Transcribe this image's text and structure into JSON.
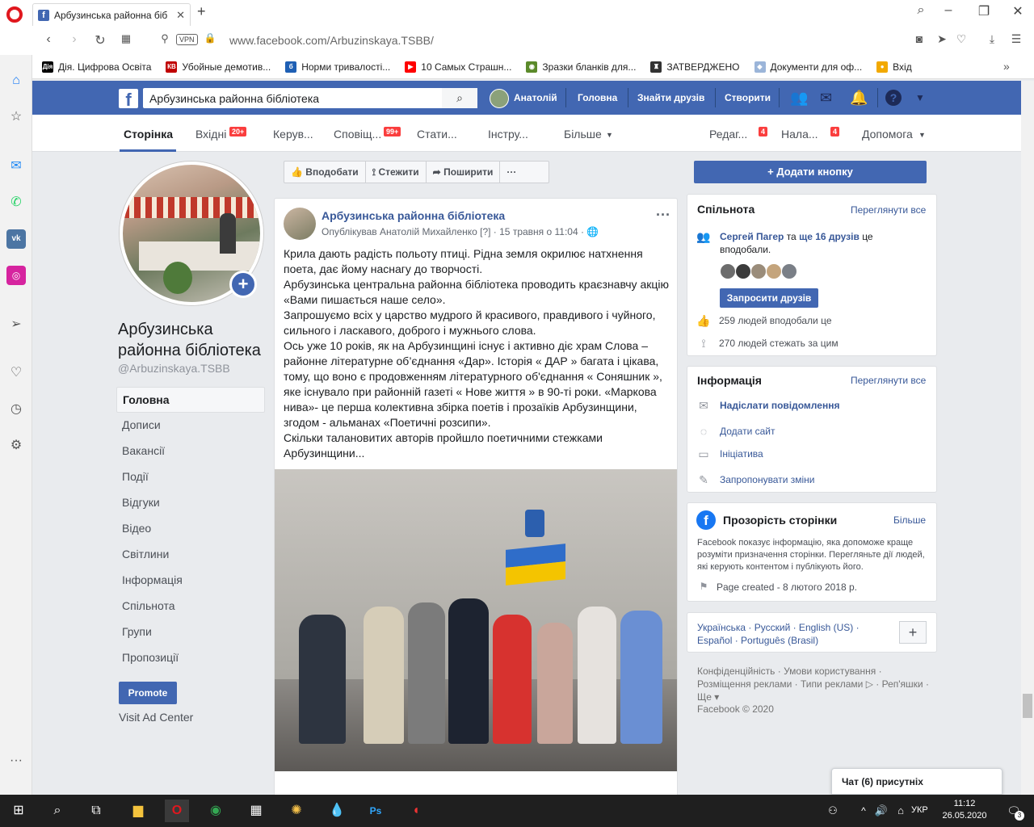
{
  "browser": {
    "tab_title": "Арбузинська районна біб",
    "url": "www.facebook.com/Arbuzinskaya.TSBB/",
    "vpn_label": "VPN",
    "bookmarks": [
      {
        "label": "Дія. Цифрова Освіта",
        "color": "#000000",
        "icon": "Дія"
      },
      {
        "label": "Убойные демотив...",
        "color": "#c00000",
        "icon": "КВ"
      },
      {
        "label": "Норми тривалості...",
        "color": "#1e5fb4",
        "icon": "б"
      },
      {
        "label": "10 Самых Страшн...",
        "color": "#ff0000",
        "icon": "▶"
      },
      {
        "label": "Зразки бланків для...",
        "color": "#5b8a2a",
        "icon": "◉"
      },
      {
        "label": "ЗАТВЕРДЖЕНО",
        "color": "#333333",
        "icon": "♜"
      },
      {
        "label": "Документи для оф...",
        "color": "#9bb5d9",
        "icon": "◆"
      },
      {
        "label": "Вхід",
        "color": "#f2a900",
        "icon": "●"
      }
    ]
  },
  "fb": {
    "search_value": "Арбузинська районна бібліотека",
    "user_name": "Анатолій",
    "nav_home": "Головна",
    "nav_find_friends": "Знайти друзів",
    "nav_create": "Створити"
  },
  "page_tabs": {
    "page": "Сторінка",
    "inbox": "Вхідні",
    "inbox_badge": "20+",
    "manage": "Керув...",
    "notif": "Сповіщ...",
    "notif_badge": "99+",
    "stats": "Стати...",
    "tools": "Інстру...",
    "more": "Більше",
    "edit": "Редаг...",
    "edit_badge": "4",
    "settings": "Нала...",
    "settings_badge": "4",
    "help": "Допомога"
  },
  "left": {
    "page_name": "Арбузинська районна бібліотека",
    "handle": "@Arbuzinskaya.TSBB",
    "nav": [
      "Головна",
      "Дописи",
      "Вакансії",
      "Події",
      "Відгуки",
      "Відео",
      "Світлини",
      "Інформація",
      "Спільнота",
      "Групи",
      "Пропозиції"
    ],
    "promote": "Promote",
    "ad_center": "Visit Ad Center"
  },
  "actions": {
    "like": "Вподобати",
    "follow": "Стежити",
    "share": "Поширити",
    "more": "···",
    "add_button": "+ Додати кнопку"
  },
  "post": {
    "author": "Арбузинська районна бібліотека",
    "meta": "Опублікував Анатолій Михайленко [?] · 15 травня о 11:04 ·",
    "text": "Крила дають радість польоту птиці. Рідна земля окрилює натхнення поета, дає йому наснагу до творчості.\nАрбузинська центральна районна бібліотека проводить краєзнавчу акцію «Вами пишається наше село».\nЗапрошуємо всіх у царство мудрого й красивого, правдивого і чуйного, сильного і ласкавого, доброго і мужнього слова.\nОсь уже 10 років, як на Арбузинщині існує і активно діє храм Слова – районне літературне об’єднання «Дар». Історія « ДАР » багата і цікава, тому, що воно є продовженням літературного об'єднання « Соняшник », яке існувало при районній газеті « Нове життя » в 90-ті роки. «Маркова нива»- це перша колективна збірка поетів і прозаїків Арбузинщини, згодом - альманах «Поетичні розсипи».\nСкільки талановитих авторів пройшло поетичними стежками Арбузинщини..."
  },
  "community": {
    "title": "Спільнота",
    "see_all": "Переглянути все",
    "friends_name": "Сергей Пагер",
    "friends_mid": " та ",
    "friends_more": "ще 16 друзів",
    "friends_tail": " це вподобали.",
    "invite": "Запросити друзів",
    "likes": "259 людей вподобали це",
    "follows": "270 людей стежать за цим"
  },
  "info": {
    "title": "Інформація",
    "see_all": "Переглянути все",
    "message": "Надіслати повідомлення",
    "website": "Додати сайт",
    "initiative": "Ініціатива",
    "suggest": "Запропонувати зміни"
  },
  "transparency": {
    "title": "Прозорість сторінки",
    "more": "Більше",
    "desc": "Facebook показує інформацію, яка допоможе краще розуміти призначення сторінки. Перегляньте дії людей, які керують контентом і публікують його.",
    "created": "Page created - 8 лютого 2018 р."
  },
  "languages": {
    "text": "Українська · Русский · English (US) · Español · Português (Brasil)",
    "plus": "+"
  },
  "footer": {
    "links": "Конфіденційність · Умови користування · Розміщення реклами · Типи реклами ▷ · Реп'яшки · Ще ▾",
    "copyright": "Facebook © 2020"
  },
  "chat": {
    "label": "Чат (6) присутніх"
  },
  "taskbar": {
    "time": "11:12",
    "date": "26.05.2020",
    "lang": "УКР",
    "notif": "3"
  },
  "colors": {
    "fb_blue": "#4267b2",
    "link": "#385898",
    "badge_red": "#fa3e3e"
  }
}
